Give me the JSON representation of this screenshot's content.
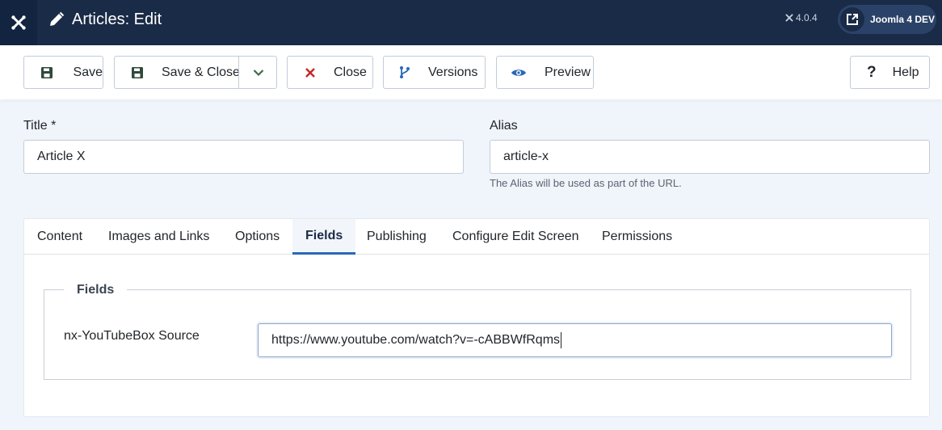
{
  "header": {
    "title": "Articles: Edit",
    "version": "4.0.4",
    "site_button": "Joomla 4 DEV",
    "logo_icon": "joomla-logo-icon"
  },
  "toolbar": {
    "save_label": "Save",
    "save_close_label": "Save & Close",
    "close_label": "Close",
    "versions_label": "Versions",
    "preview_label": "Preview",
    "help_label": "Help",
    "colors": {
      "save_icon": "#2f4a3a",
      "close_icon": "#c52827",
      "versions_icon": "#2a69b8",
      "preview_icon": "#2a69b8"
    }
  },
  "form": {
    "title_label": "Title *",
    "title_value": "Article X",
    "alias_label": "Alias",
    "alias_value": "article-x",
    "alias_hint": "The Alias will be used as part of the URL."
  },
  "tabs": [
    {
      "label": "Content",
      "active": false
    },
    {
      "label": "Images and Links",
      "active": false
    },
    {
      "label": "Options",
      "active": false
    },
    {
      "label": "Fields",
      "active": true
    },
    {
      "label": "Publishing",
      "active": false
    },
    {
      "label": "Configure Edit Screen",
      "active": false
    },
    {
      "label": "Permissions",
      "active": false
    }
  ],
  "fields_panel": {
    "legend": "Fields",
    "field_label": "nx-YouTubeBox Source",
    "field_value": "https://www.youtube.com/watch?v=-cABBWfRqms"
  }
}
